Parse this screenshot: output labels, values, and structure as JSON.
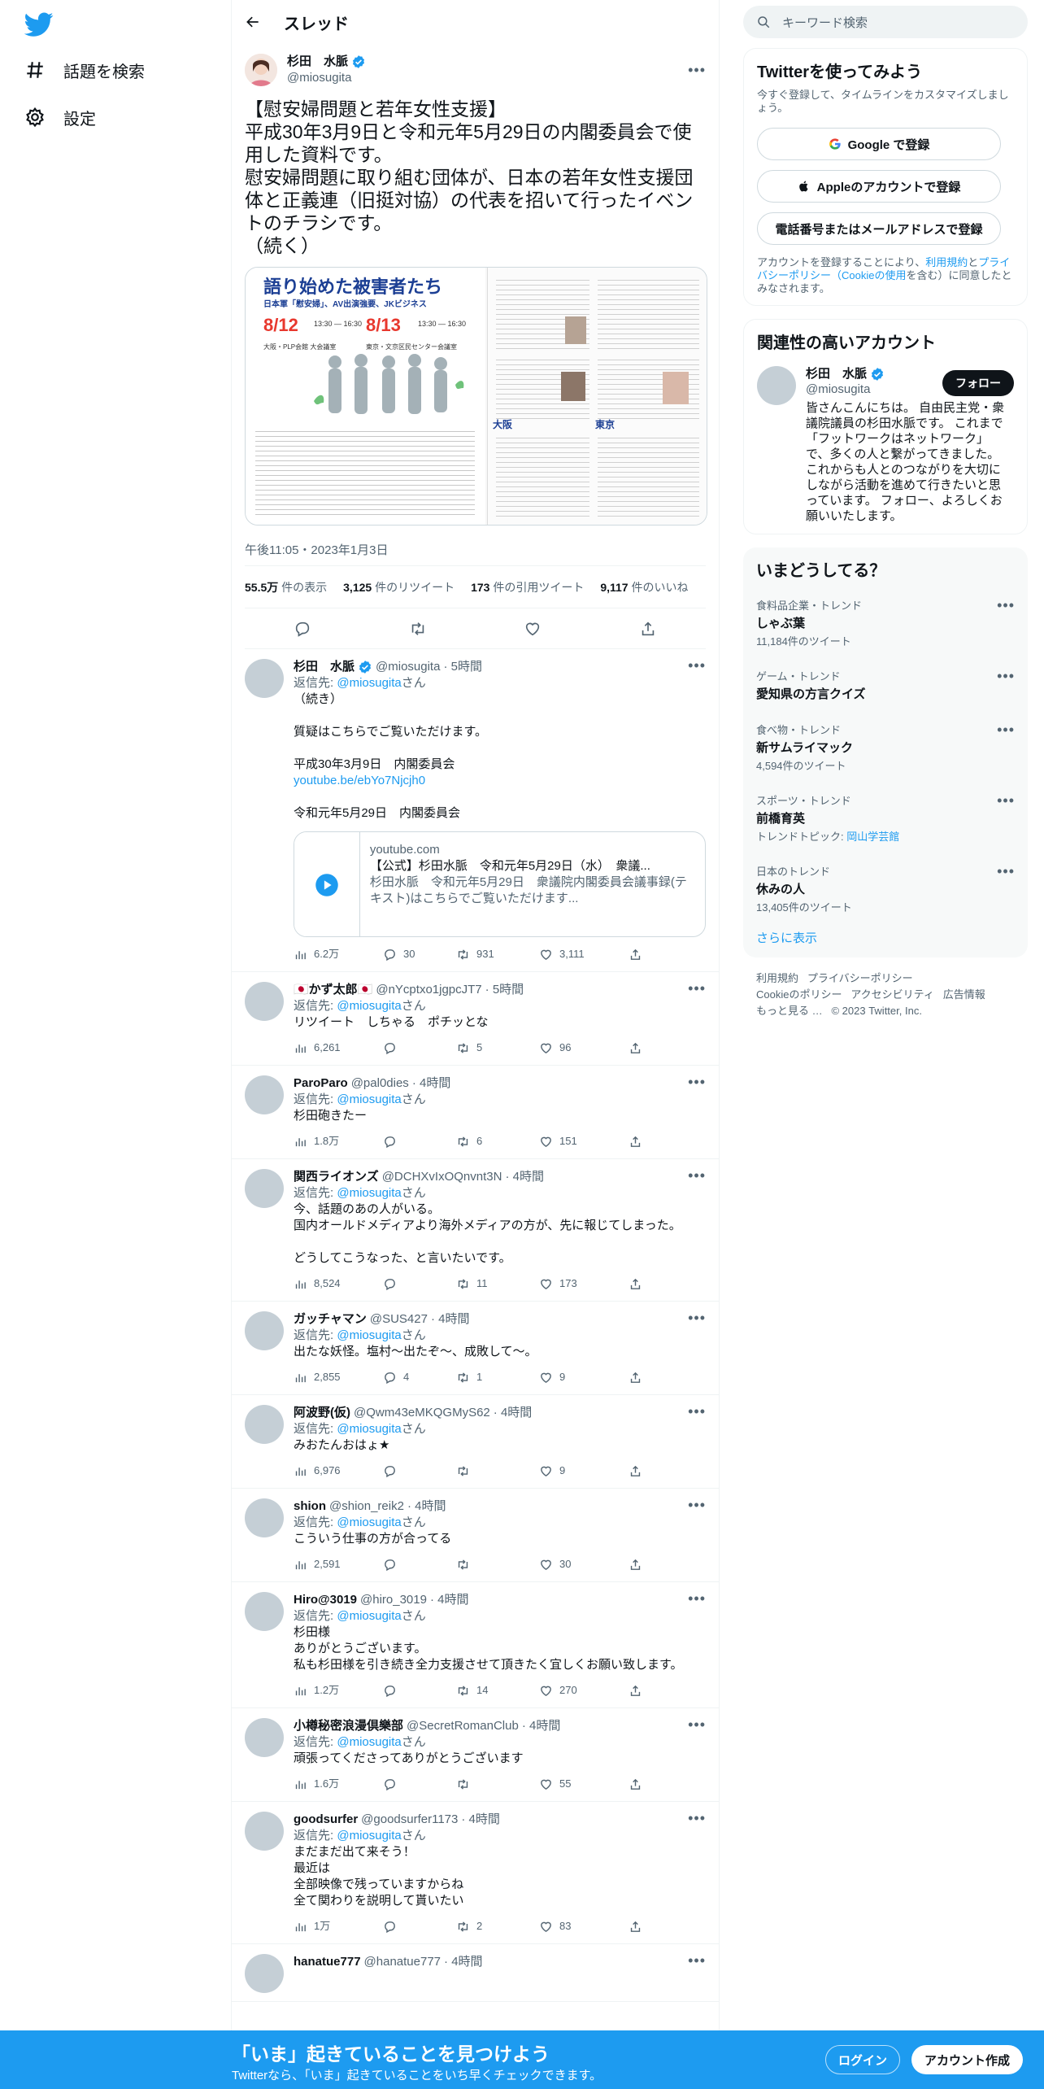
{
  "nav": {
    "explore": "話題を検索",
    "settings": "設定"
  },
  "header": {
    "title": "スレッド"
  },
  "main_tweet": {
    "name": "杉田　水脈",
    "handle": "@miosugita",
    "text": "【慰安婦問題と若年女性支援】\n平成30年3月9日と令和元年5月29日の内閣委員会で使用した資料です。\n慰安婦問題に取り組む団体が、日本の若年女性支援団体と正義連（旧挺対協）の代表を招いて行ったイベントのチラシです。\n（続く）",
    "flyer_title": "語り始めた被害者たち",
    "flyer_subtitle": "日本軍「慰安婦」、AV出演強要、JKビジネス",
    "flyer_date1": "8/12",
    "flyer_date2": "8/13",
    "flyer_time1": "13:30 ― 16:30",
    "flyer_time2": "13:30 ― 16:30",
    "flyer_place1": "大阪・PLP会館 大会議室",
    "flyer_place2": "東京・文京区民センター会議室",
    "flyer_osaka": "大阪",
    "flyer_tokyo": "東京",
    "time": "午後11:05・2023年1月3日",
    "views_n": "55.5万",
    "views_l": " 件の表示",
    "rt_n": "3,125",
    "rt_l": " 件のリツイート",
    "qt_n": "173",
    "qt_l": " 件の引用ツイート",
    "likes_n": "9,117",
    "likes_l": " 件のいいね"
  },
  "replies": [
    {
      "name": "杉田　水脈",
      "handle": "@miosugita",
      "time": "· 5時間",
      "verified": true,
      "reply_to": "返信先: ",
      "reply_handle": "@miosugita",
      "reply_suffix": "さん",
      "text": "（続き）\n\n質疑はこちらでご覧いただけます。\n\n平成30年3月9日　内閣委員会",
      "link": "youtube.be/ebYo7Njcjh0",
      "text2": "\n令和元年5月29日　内閣委員会",
      "card": {
        "domain": "youtube.com",
        "title": "【公式】杉田水脈　令和元年5月29日（水）　衆議...",
        "desc": "杉田水脈　令和元年5月29日　衆議院内閣委員会議事録(テキスト)はこちらでご覧いただけます..."
      },
      "views": "6.2万",
      "replies": "30",
      "retweets": "931",
      "likes": "3,111"
    },
    {
      "name": "🇯🇵かず太郎🇯🇵",
      "handle": "@nYcptxo1jgpcJT7",
      "time": "· 5時間",
      "reply_to": "返信先: ",
      "reply_handle": "@miosugita",
      "reply_suffix": "さん",
      "text": "リツイート　しちゃる　ポチッとな",
      "views": "6,261",
      "replies": "",
      "retweets": "5",
      "likes": "96"
    },
    {
      "name": "ParoParo",
      "handle": "@pal0dies",
      "time": "· 4時間",
      "reply_to": "返信先: ",
      "reply_handle": "@miosugita",
      "reply_suffix": "さん",
      "text": "杉田砲きたー",
      "views": "1.8万",
      "replies": "",
      "retweets": "6",
      "likes": "151"
    },
    {
      "name": "関西ライオンズ",
      "handle": "@DCHXvIxOQnvnt3N",
      "time": "· 4時間",
      "reply_to": "返信先: ",
      "reply_handle": "@miosugita",
      "reply_suffix": "さん",
      "text": "今、話題のあの人がいる。\n国内オールドメディアより海外メディアの方が、先に報じてしまった。\n\nどうしてこうなった、と言いたいです。",
      "views": "8,524",
      "replies": "",
      "retweets": "11",
      "likes": "173"
    },
    {
      "name": "ガッチャマン",
      "handle": "@SUS427",
      "time": "· 4時間",
      "reply_to": "返信先: ",
      "reply_handle": "@miosugita",
      "reply_suffix": "さん",
      "text": "出たな妖怪。塩村～出たぞ～、成敗して〜。",
      "views": "2,855",
      "replies": "4",
      "retweets": "1",
      "likes": "9"
    },
    {
      "name": "阿波野(仮)",
      "handle": "@Qwm43eMKQGMyS62",
      "time": "· 4時間",
      "reply_to": "返信先: ",
      "reply_handle": "@miosugita",
      "reply_suffix": "さん",
      "text": "みおたんおはょ★",
      "views": "6,976",
      "replies": "",
      "retweets": "",
      "likes": "9"
    },
    {
      "name": "shion",
      "handle": "@shion_reik2",
      "time": "· 4時間",
      "reply_to": "返信先: ",
      "reply_handle": "@miosugita",
      "reply_suffix": "さん",
      "text": "こういう仕事の方が合ってる",
      "views": "2,591",
      "replies": "",
      "retweets": "",
      "likes": "30"
    },
    {
      "name": "Hiro@3019",
      "handle": "@hiro_3019",
      "time": "· 4時間",
      "reply_to": "返信先: ",
      "reply_handle": "@miosugita",
      "reply_suffix": "さん",
      "text": "杉田様\nありがとうございます。\n私も杉田様を引き続き全力支援させて頂きたく宜しくお願い致します。",
      "views": "1.2万",
      "replies": "",
      "retweets": "14",
      "likes": "270"
    },
    {
      "name": "小樽秘密浪漫倶樂部",
      "handle": "@SecretRomanClub",
      "time": "· 4時間",
      "reply_to": "返信先: ",
      "reply_handle": "@miosugita",
      "reply_suffix": "さん",
      "text": "頑張ってくださってありがとうございます",
      "views": "1.6万",
      "replies": "",
      "retweets": "",
      "likes": "55"
    },
    {
      "name": "goodsurfer",
      "handle": "@goodsurfer1173",
      "time": "· 4時間",
      "reply_to": "返信先: ",
      "reply_handle": "@miosugita",
      "reply_suffix": "さん",
      "text": "まだまだ出て来そう！\n最近は\n全部映像で残っていますからね\n全て関わりを説明して貰いたい",
      "views": "1万",
      "replies": "",
      "retweets": "2",
      "likes": "83"
    },
    {
      "name": "hanatue777",
      "handle": "@hanatue777",
      "time": "· 4時間"
    }
  ],
  "right": {
    "search_placeholder": "キーワード検索",
    "signup": {
      "title": "Twitterを使ってみよう",
      "desc": "今すぐ登録して、タイムラインをカスタマイズしましょう。",
      "google": "Google で登録",
      "apple": "Appleのアカウントで登録",
      "phone": "電話番号またはメールアドレスで登録",
      "terms_pre": "アカウントを登録することにより、",
      "terms_link1": "利用規約",
      "terms_mid": "と",
      "terms_link2": "プライバシーポリシー（Cookieの使用",
      "terms_post": "を含む）に同意したとみなされます。"
    },
    "related": {
      "title": "関連性の高いアカウント",
      "name": "杉田　水脈",
      "handle": "@miosugita",
      "follow": "フォロー",
      "bio": "皆さんこんにちは。 自由民主党・衆議院議員の杉田水脈です。 これまで「フットワークはネットワーク」で、多くの人と繋がってきました。これからも人とのつながりを大切にしながら活動を進めて行きたいと思っています。 フォロー、よろしくお願いいたします。"
    },
    "trends": {
      "title": "いまどうしてる？",
      "items": [
        {
          "cat": "食料品企業・トレンド",
          "title": "しゃぶ葉",
          "count": "11,184件のツイート"
        },
        {
          "cat": "ゲーム・トレンド",
          "title": "愛知県の方言クイズ",
          "count": ""
        },
        {
          "cat": "食べ物・トレンド",
          "title": "新サムライマック",
          "count": "4,594件のツイート"
        },
        {
          "cat": "スポーツ・トレンド",
          "title": "前橋育英",
          "count_pre": "トレンドトピック: ",
          "count_link": "岡山学芸館"
        },
        {
          "cat": "日本のトレンド",
          "title": "休みの人",
          "count": "13,405件のツイート"
        }
      ],
      "more": "さらに表示"
    },
    "footer": {
      "l1": "利用規約",
      "l2": "プライバシーポリシー",
      "l3": "Cookieのポリシー",
      "l4": "アクセシビリティ",
      "l5": "広告情報",
      "l6": "もっと見る …",
      "copy": "© 2023 Twitter, Inc."
    }
  },
  "bottom": {
    "title": "「いま」起きていることを見つけよう",
    "sub": "Twitterなら、「いま」起きていることをいち早くチェックできます。",
    "login": "ログイン",
    "signup": "アカウント作成"
  },
  "colors": {
    "accent": "#1d9bf0",
    "text": "#0f1419",
    "muted": "#536471",
    "border": "#eff3f4"
  }
}
